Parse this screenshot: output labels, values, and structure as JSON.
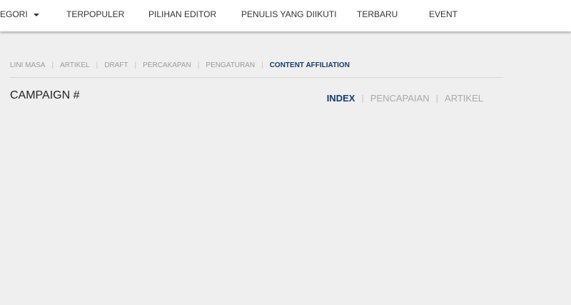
{
  "top_nav": {
    "items": [
      {
        "label": "EGORI",
        "has_dropdown": true
      },
      {
        "label": "TERPOPULER"
      },
      {
        "label": "PILIHAN EDITOR"
      },
      {
        "label": "PENULIS YANG DIIKUTI"
      },
      {
        "label": "TERBARU"
      },
      {
        "label": "EVENT"
      }
    ]
  },
  "sub_nav": {
    "items": [
      {
        "label": "LINI MASA"
      },
      {
        "label": "ARTIKEL"
      },
      {
        "label": "DRAFT"
      },
      {
        "label": "PERCAKAPAN"
      },
      {
        "label": "PENGATURAN"
      },
      {
        "label": "CONTENT AFFILIATION",
        "active": true
      }
    ],
    "separator": "|"
  },
  "page": {
    "title": "CAMPAIGN #"
  },
  "tabs": {
    "items": [
      {
        "label": "INDEX",
        "active": true
      },
      {
        "label": "PENCAPAIAN"
      },
      {
        "label": "ARTIKEL"
      }
    ],
    "separator": "|"
  },
  "colors": {
    "background": "#efefef",
    "header_bg": "#ffffff",
    "active_accent": "#173b6c",
    "muted_text": "#9a9a9a"
  }
}
